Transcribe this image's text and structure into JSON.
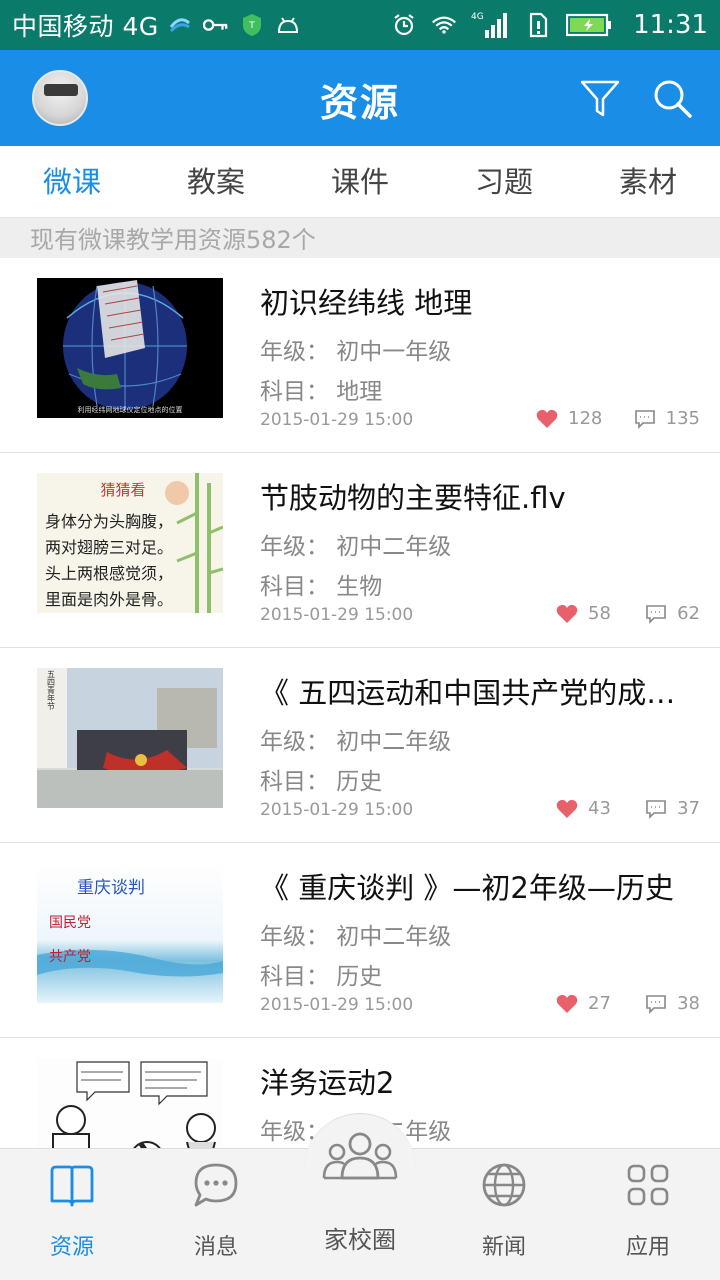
{
  "status_bar": {
    "carrier": "中国移动 4G",
    "network_type": "4G",
    "time": "11:31"
  },
  "header": {
    "title": "资源"
  },
  "tabs": [
    {
      "label": "微课",
      "active": true
    },
    {
      "label": "教案",
      "active": false
    },
    {
      "label": "课件",
      "active": false
    },
    {
      "label": "习题",
      "active": false
    },
    {
      "label": "素材",
      "active": false
    }
  ],
  "info_bar": {
    "text": "现有微课教学用资源582个"
  },
  "items": [
    {
      "title": "初识经纬线 地理",
      "grade": "年级：  初中一年级",
      "subject": "科目：  地理",
      "date": "2015-01-29 15:00",
      "likes": "128",
      "comments": "135",
      "thumb_caption": "利用经纬网地球仪定位地点的位置"
    },
    {
      "title": "节肢动物的主要特征.flv",
      "grade": "年级：  初中二年级",
      "subject": "科目：  生物",
      "date": "2015-01-29 15:00",
      "likes": "58",
      "comments": "62",
      "thumb_heading": "猜猜看",
      "thumb_lines": [
        "身体分为头胸腹，",
        "两对翅膀三对足。",
        "头上两根感觉须，",
        "里面是肉外是骨。"
      ]
    },
    {
      "title": "《 五四运动和中国共产党的成立 》",
      "grade": "年级：  初中二年级",
      "subject": "科目：  历史",
      "date": "2015-01-29 15:00",
      "likes": "43",
      "comments": "37",
      "thumb_vertical_text": "五四青年节"
    },
    {
      "title": "《 重庆谈判 》—初2年级—历史",
      "grade": "年级：  初中二年级",
      "subject": "科目：  历史",
      "date": "2015-01-29 15:00",
      "likes": "27",
      "comments": "38",
      "thumb_lines": [
        "重庆谈判",
        "国民党",
        "共产党"
      ]
    },
    {
      "title": "洋务运动2",
      "grade": "年级：  初中二年级",
      "subject": "",
      "date": "",
      "likes": "",
      "comments": ""
    }
  ],
  "bottom_nav": [
    {
      "label": "资源",
      "icon": "book-icon",
      "active": true
    },
    {
      "label": "消息",
      "icon": "chat-bubble-icon",
      "active": false
    },
    {
      "label": "家校圈",
      "icon": "group-icon",
      "active": false
    },
    {
      "label": "新闻",
      "icon": "globe-icon",
      "active": false
    },
    {
      "label": "应用",
      "icon": "apps-grid-icon",
      "active": false
    }
  ],
  "colors": {
    "status_bar": "#0a7a6a",
    "primary": "#1a8ee6",
    "like_heart": "#e8606a"
  }
}
